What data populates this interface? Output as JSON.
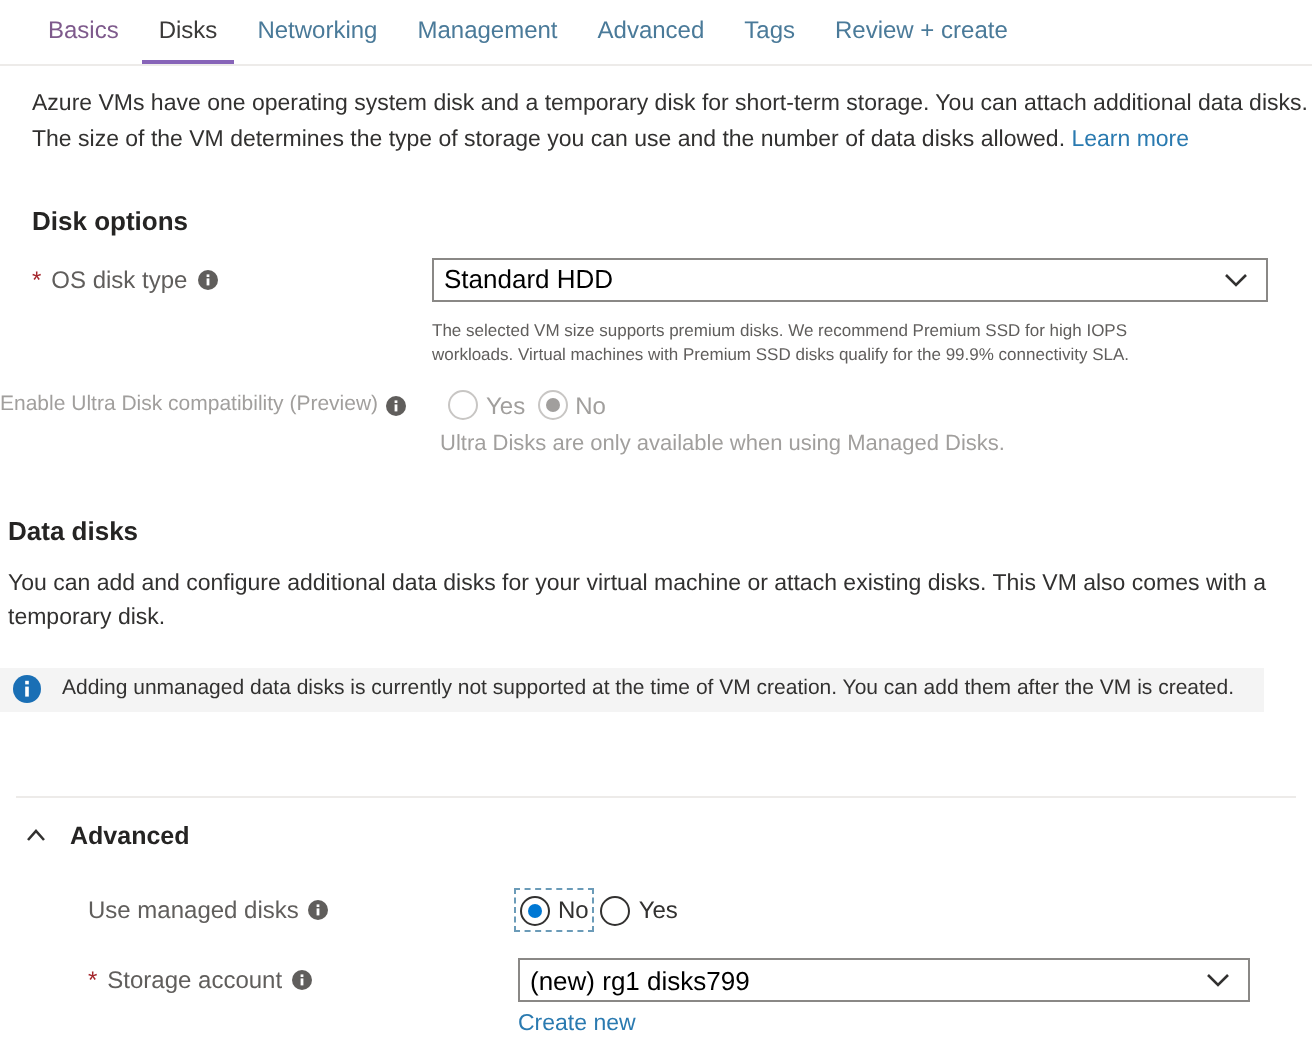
{
  "tabs": [
    {
      "label": "Basics",
      "selected": false
    },
    {
      "label": "Disks",
      "selected": true
    },
    {
      "label": "Networking",
      "selected": false
    },
    {
      "label": "Management",
      "selected": false
    },
    {
      "label": "Advanced",
      "selected": false
    },
    {
      "label": "Tags",
      "selected": false
    },
    {
      "label": "Review + create",
      "selected": false
    }
  ],
  "intro": {
    "text": "Azure VMs have one operating system disk and a temporary disk for short-term storage. You can attach additional data disks. The size of the VM determines the type of storage you can use and the number of data disks allowed.",
    "link": "Learn more"
  },
  "disk_options": {
    "heading": "Disk options",
    "os_disk_type": {
      "required_mark": "*",
      "label": "OS disk type",
      "value": "Standard HDD",
      "hint": "The selected VM size supports premium disks. We recommend Premium SSD for high IOPS workloads. Virtual machines with Premium SSD disks qualify for the 99.9% connectivity SLA."
    },
    "ultra_disk": {
      "label": "Enable Ultra Disk compatibility (Preview)",
      "disabled": true,
      "options": [
        {
          "label": "Yes",
          "selected": false
        },
        {
          "label": "No",
          "selected": true
        }
      ],
      "hint": "Ultra Disks are only available when using Managed Disks."
    }
  },
  "data_disks": {
    "heading": "Data disks",
    "text": "You can add and configure additional data disks for your virtual machine or attach existing disks. This VM also comes with a temporary disk.",
    "info": "Adding unmanaged data disks is currently not supported at the time of VM creation. You can add them after the VM is created."
  },
  "advanced": {
    "heading": "Advanced",
    "expanded": true,
    "use_managed_disks": {
      "label": "Use managed disks",
      "options": [
        {
          "label": "No",
          "selected": true
        },
        {
          "label": "Yes",
          "selected": false
        }
      ]
    },
    "storage_account": {
      "required_mark": "*",
      "label": "Storage account",
      "value": "(new) rg1 disks799",
      "link": "Create new"
    }
  }
}
